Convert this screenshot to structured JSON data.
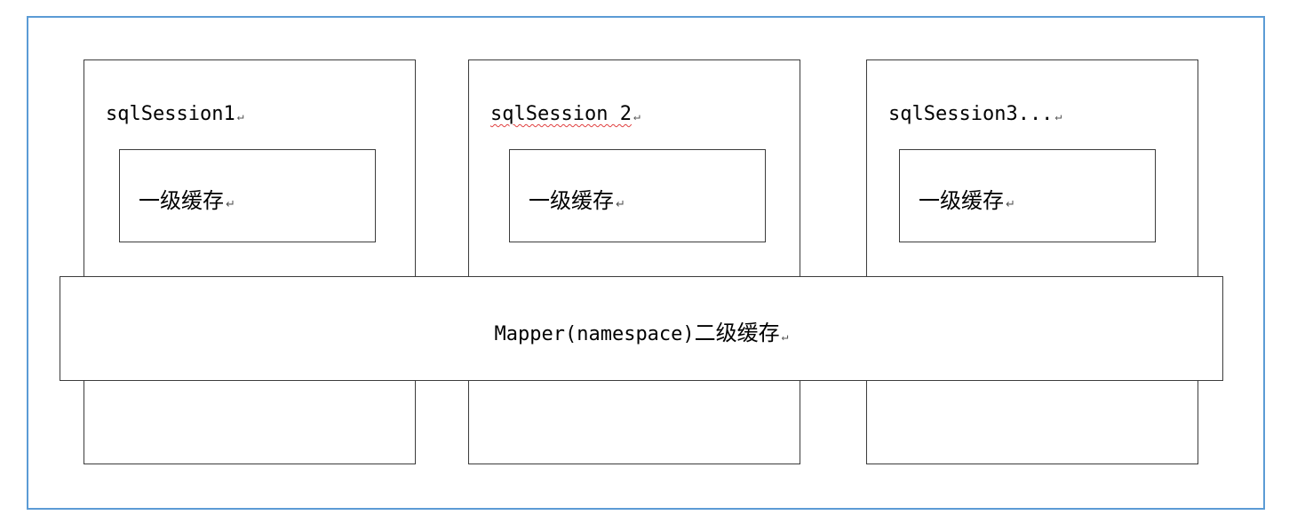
{
  "sessions": [
    {
      "label": "sqlSession1",
      "cache_label": "一级缓存"
    },
    {
      "label": "sqlSession 2",
      "cache_label": "一级缓存"
    },
    {
      "label": "sqlSession3...",
      "cache_label": "一级缓存"
    }
  ],
  "mapper": {
    "label_code": "Mapper(namespace)",
    "label_text": "二级缓存"
  },
  "paragraph_mark": "↵",
  "colors": {
    "frame_border": "#5b9bd5",
    "box_border": "#3c3c3c",
    "spellcheck_underline": "#e04040"
  }
}
